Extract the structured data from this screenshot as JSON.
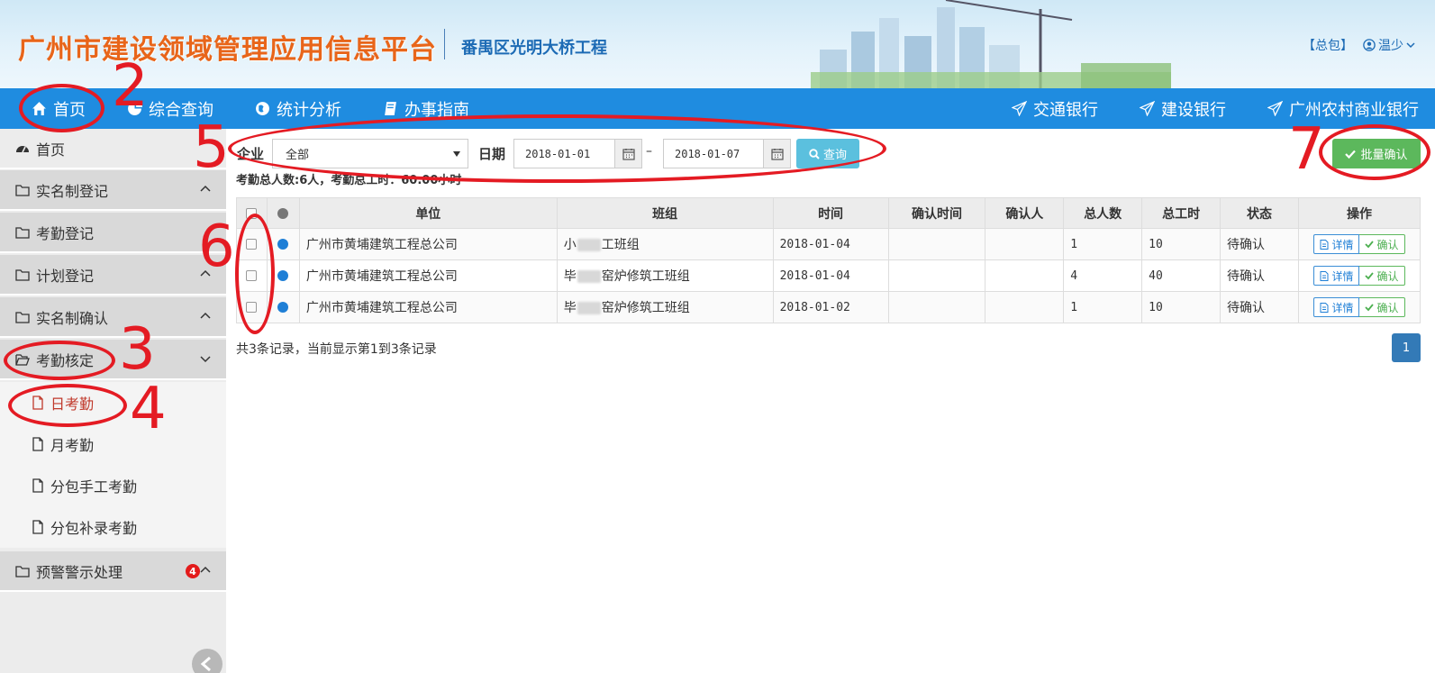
{
  "header": {
    "title": "广州市建设领域管理应用信息平台",
    "project": "番禺区光明大桥工程",
    "tag": "【总包】",
    "user": "温少"
  },
  "nav": {
    "left": [
      {
        "label": "首页",
        "icon": "home-icon"
      },
      {
        "label": "综合查询",
        "icon": "pie-icon"
      },
      {
        "label": "统计分析",
        "icon": "globe-icon"
      },
      {
        "label": "办事指南",
        "icon": "book-icon"
      }
    ],
    "right": [
      {
        "label": "交通银行",
        "icon": "send-icon"
      },
      {
        "label": "建设银行",
        "icon": "send-icon"
      },
      {
        "label": "广州农村商业银行",
        "icon": "send-icon"
      }
    ]
  },
  "sidebar": {
    "home": "首页",
    "groups": [
      {
        "label": "实名制登记"
      },
      {
        "label": "考勤登记"
      },
      {
        "label": "计划登记"
      },
      {
        "label": "实名制确认"
      },
      {
        "label": "考勤核定"
      }
    ],
    "sub_items": [
      {
        "label": "日考勤"
      },
      {
        "label": "月考勤"
      },
      {
        "label": "分包手工考勤"
      },
      {
        "label": "分包补录考勤"
      }
    ],
    "warning": {
      "label": "预警警示处理",
      "badge": "4"
    }
  },
  "toolbar": {
    "company_label": "企业",
    "company_value": "全部",
    "date_label": "日期",
    "date_from": "2018-01-01",
    "date_sep": "–",
    "date_to": "2018-01-07",
    "query_label": "查询",
    "batch_label": "批量确认"
  },
  "summary": "考勤总人数:6人，考勤总工时：60.00小时",
  "table": {
    "headers": [
      "单位",
      "班组",
      "时间",
      "确认时间",
      "确认人",
      "总人数",
      "总工时",
      "状态",
      "操作"
    ],
    "rows": [
      {
        "unit": "广州市黄埔建筑工程总公司",
        "team_a": "小",
        "team_b": "工班组",
        "date": "2018-01-04",
        "confirm_time": "",
        "confirmer": "",
        "people": "1",
        "hours": "10",
        "status": "待确认"
      },
      {
        "unit": "广州市黄埔建筑工程总公司",
        "team_a": "毕",
        "team_b": "窑炉修筑工班组",
        "date": "2018-01-04",
        "confirm_time": "",
        "confirmer": "",
        "people": "4",
        "hours": "40",
        "status": "待确认"
      },
      {
        "unit": "广州市黄埔建筑工程总公司",
        "team_a": "毕",
        "team_b": "窑炉修筑工班组",
        "date": "2018-01-02",
        "confirm_time": "",
        "confirmer": "",
        "people": "1",
        "hours": "10",
        "status": "待确认"
      }
    ],
    "detail_label": "详情",
    "confirm_label": "确认"
  },
  "footer": {
    "info": "共3条记录，当前显示第1到3条记录",
    "page": "1"
  },
  "annotations": [
    "2",
    "3",
    "4",
    "5",
    "6",
    "7"
  ],
  "colors": {
    "nav": "#1f8ce0",
    "title": "#e8651a",
    "annotation": "#e41b23",
    "success": "#5cb85c",
    "info": "#5bc0de"
  }
}
